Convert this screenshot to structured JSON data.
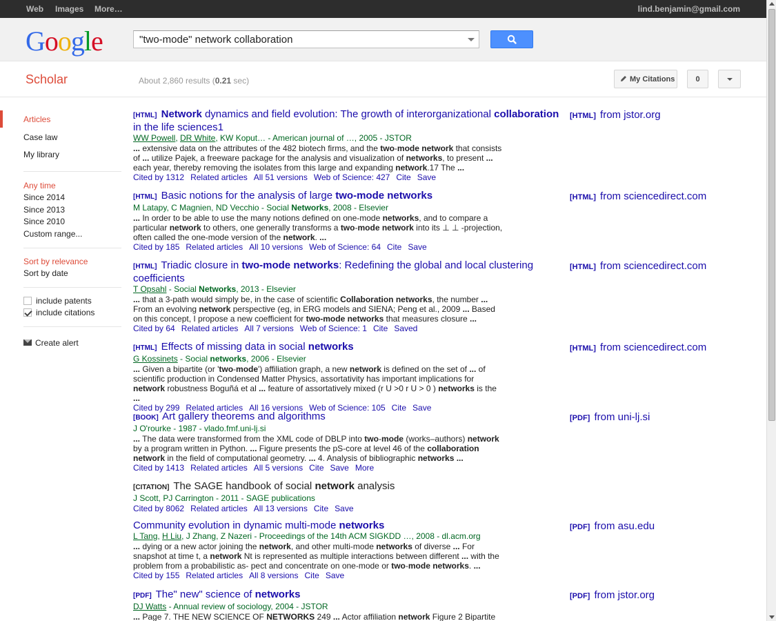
{
  "topbar": {
    "nav": [
      "Web",
      "Images",
      "More…"
    ],
    "user": "lind.benjamin@gmail.com"
  },
  "search": {
    "query": "\"two-mode\" network collaboration"
  },
  "brand": {
    "logo_letters": [
      "G",
      "o",
      "o",
      "g",
      "l",
      "e"
    ],
    "logo_colors": [
      "#3369e8",
      "#d50f25",
      "#eeb211",
      "#3369e8",
      "#009925",
      "#d50f25"
    ],
    "section": "Scholar"
  },
  "stats": {
    "prefix": "About 2,860 results (",
    "time": "0.21",
    "suffix": " sec)"
  },
  "toolbar": {
    "my_citations": "My Citations",
    "alerts_count": "0"
  },
  "sidebar": {
    "articles": "Articles",
    "case_law": "Case law",
    "my_library": "My library",
    "any_time": "Any time",
    "since_2014": "Since 2014",
    "since_2013": "Since 2013",
    "since_2010": "Since 2010",
    "custom_range": "Custom range...",
    "sort_relevance": "Sort by relevance",
    "sort_date": "Sort by date",
    "include_patents": "include patents",
    "include_citations": "include citations",
    "create_alert": "Create alert"
  },
  "results": [
    {
      "tag": "[HTML]",
      "title_parts": [
        [
          "Network",
          true
        ],
        [
          " dynamics and field evolution: The growth of interorganizational ",
          false
        ],
        [
          "collaboration",
          true
        ],
        [
          " in the life sciences1",
          false
        ]
      ],
      "meta": [
        [
          "WW Powell",
          true
        ],
        [
          ", ",
          false
        ],
        [
          "DR White",
          true
        ],
        [
          ", KW Koput… - American journal of …, 2005 - JSTOR",
          false
        ]
      ],
      "snippet": [
        [
          "...",
          true
        ],
        [
          " extensive data on the attributes of the 482 biotech firms, and the ",
          false
        ],
        [
          "two",
          true
        ],
        [
          "-",
          false
        ],
        [
          "mode network",
          true
        ],
        [
          " that consists of ",
          false
        ],
        [
          "...",
          true
        ],
        [
          " utilize Pajek, a freeware package for the analysis and visualization of ",
          false
        ],
        [
          "networks",
          true
        ],
        [
          ", to present ",
          false
        ],
        [
          "...",
          true
        ],
        [
          " each year, thereby removing the isolates from this large and expanding ",
          false
        ],
        [
          "network",
          true
        ],
        [
          ".17 The ",
          false
        ],
        [
          "...",
          true
        ]
      ],
      "links": [
        "Cited by 1312",
        "Related articles",
        "All 51 versions",
        "Web of Science: 427",
        "Cite",
        "Save"
      ],
      "side_tag": "[HTML]",
      "side_source": "from jstor.org"
    },
    {
      "tag": "[HTML]",
      "title_parts": [
        [
          "Basic notions for the analysis of large ",
          false
        ],
        [
          "two-mode networks",
          true
        ]
      ],
      "meta": [
        [
          "M Latapy, C Magnien, ND Vecchio - Social ",
          false
        ],
        [
          "Networks",
          "b"
        ],
        [
          ", 2008 - Elsevier",
          false
        ]
      ],
      "snippet": [
        [
          "...",
          true
        ],
        [
          " In order to be able to use the many notions defined on one-mode ",
          false
        ],
        [
          "networks",
          true
        ],
        [
          ", and to compare a particular ",
          false
        ],
        [
          "network",
          true
        ],
        [
          " to others, one generally transforms a ",
          false
        ],
        [
          "two",
          true
        ],
        [
          "-",
          false
        ],
        [
          "mode network",
          true
        ],
        [
          " into its ⊥ ⊥ -projection, often called the one-mode version of the ",
          false
        ],
        [
          "network",
          true
        ],
        [
          ". ",
          false
        ],
        [
          "...",
          true
        ]
      ],
      "links": [
        "Cited by 185",
        "Related articles",
        "All 10 versions",
        "Web of Science: 64",
        "Cite",
        "Save"
      ],
      "side_tag": "[HTML]",
      "side_source": "from sciencedirect.com"
    },
    {
      "tag": "[HTML]",
      "title_parts": [
        [
          "Triadic closure in ",
          false
        ],
        [
          "two-mode networks",
          true
        ],
        [
          ": Redefining the global and local clustering coefficients",
          false
        ]
      ],
      "meta": [
        [
          "T Opsahl",
          true
        ],
        [
          " - Social ",
          false
        ],
        [
          "Networks",
          "b"
        ],
        [
          ", 2013 - Elsevier",
          false
        ]
      ],
      "snippet": [
        [
          "...",
          true
        ],
        [
          " that a 3-path would simply be, in the case of scientific ",
          false
        ],
        [
          "Collaboration networks",
          true
        ],
        [
          ", the number ",
          false
        ],
        [
          "...",
          true
        ],
        [
          " From an evolving ",
          false
        ],
        [
          "network",
          true
        ],
        [
          " perspective (eg, in ERG models and SIENA; Peng et al., 2009 ",
          false
        ],
        [
          "...",
          true
        ],
        [
          " Based on this concept, I propose a new coefficient for ",
          false
        ],
        [
          "two-mode networks",
          true
        ],
        [
          " that measures closure ",
          false
        ],
        [
          "...",
          true
        ]
      ],
      "links": [
        "Cited by 64",
        "Related articles",
        "All 7 versions",
        "Web of Science: 1",
        "Cite",
        "Saved"
      ],
      "side_tag": "[HTML]",
      "side_source": "from sciencedirect.com"
    },
    {
      "tag": "[HTML]",
      "title_parts": [
        [
          "Effects of missing data in social ",
          false
        ],
        [
          "networks",
          true
        ]
      ],
      "meta": [
        [
          "G Kossinets",
          true
        ],
        [
          " - Social ",
          false
        ],
        [
          "networks",
          "b"
        ],
        [
          ", 2006 - Elsevier",
          false
        ]
      ],
      "snippet": [
        [
          "...",
          true
        ],
        [
          " Given a bipartite (or '",
          false
        ],
        [
          "two",
          true
        ],
        [
          "-",
          false
        ],
        [
          "mode",
          true
        ],
        [
          "') affiliation graph, a new ",
          false
        ],
        [
          "network",
          true
        ],
        [
          " is defined on the set of ",
          false
        ],
        [
          "...",
          true
        ],
        [
          " of scientific production in Condensed Matter Physics, assortativity has important implications for ",
          false
        ],
        [
          "network",
          true
        ],
        [
          " robustness Boguñá et al ",
          false
        ],
        [
          "...",
          true
        ],
        [
          " feature of assortatively mixed (r U >0 r U > 0 ) ",
          false
        ],
        [
          "networks",
          true
        ],
        [
          " is the ",
          false
        ],
        [
          "...",
          true
        ]
      ],
      "links": [
        "Cited by 299",
        "Related articles",
        "All 16 versions",
        "Web of Science: 105",
        "Cite",
        "Save"
      ],
      "side_tag": "[HTML]",
      "side_source": "from sciencedirect.com"
    },
    {
      "tag": "[BOOK]",
      "title_parts": [
        [
          "Art gallery theorems and algorithms",
          false
        ]
      ],
      "meta": [
        [
          "J O'rourke - 1987 - vlado.fmf.uni-lj.si",
          false
        ]
      ],
      "snippet": [
        [
          "...",
          true
        ],
        [
          " The data were transformed from the XML code of DBLP into ",
          false
        ],
        [
          "two",
          true
        ],
        [
          "-",
          false
        ],
        [
          "mode",
          true
        ],
        [
          " (works–authors) ",
          false
        ],
        [
          "network",
          true
        ],
        [
          " by a program written in Python. ",
          false
        ],
        [
          "...",
          true
        ],
        [
          " Figure presents the pS-core at level 46 of the ",
          false
        ],
        [
          "collaboration network",
          true
        ],
        [
          " in the field of computational geometry. ",
          false
        ],
        [
          "...",
          true
        ],
        [
          " 4. Analysis of bibliographic ",
          false
        ],
        [
          "networks",
          true
        ],
        [
          " ",
          false
        ],
        [
          "...",
          true
        ]
      ],
      "links": [
        "Cited by 1413",
        "Related articles",
        "All 5 versions",
        "Cite",
        "Save",
        "More"
      ],
      "side_tag": "[PDF]",
      "side_source": "from uni-lj.si"
    },
    {
      "tag": "[CITATION]",
      "plain": true,
      "title_parts": [
        [
          "The SAGE handbook of social ",
          false
        ],
        [
          "network",
          true
        ],
        [
          " analysis",
          false
        ]
      ],
      "meta": [
        [
          "J Scott, PJ Carrington - 2011 - SAGE publications",
          false
        ]
      ],
      "snippet": [],
      "links": [
        "Cited by 8062",
        "Related articles",
        "All 13 versions",
        "Cite",
        "Save"
      ],
      "side_tag": "",
      "side_source": ""
    },
    {
      "tag": "",
      "title_parts": [
        [
          "Community evolution in dynamic multi-mode ",
          false
        ],
        [
          "networks",
          true
        ]
      ],
      "meta": [
        [
          "L Tang",
          true
        ],
        [
          ", ",
          false
        ],
        [
          "H Liu",
          true
        ],
        [
          ", J Zhang, Z Nazeri - Proceedings of the 14th ACM SIGKDD …, 2008 - dl.acm.org",
          false
        ]
      ],
      "snippet": [
        [
          "...",
          true
        ],
        [
          " dying or a new actor joining the ",
          false
        ],
        [
          "network",
          true
        ],
        [
          ", and other multi-mode ",
          false
        ],
        [
          "networks",
          true
        ],
        [
          " of diverse ",
          false
        ],
        [
          "...",
          true
        ],
        [
          " For snapshot at time t, a ",
          false
        ],
        [
          "network",
          true
        ],
        [
          " Nt is represented as multiple interactions between different ",
          false
        ],
        [
          "...",
          true
        ],
        [
          " with the problem from a probabilistic as- pect and concentrate on one-mode or ",
          false
        ],
        [
          "two",
          true
        ],
        [
          "-",
          false
        ],
        [
          "mode networks",
          true
        ],
        [
          ". ",
          false
        ],
        [
          "...",
          true
        ]
      ],
      "links": [
        "Cited by 155",
        "Related articles",
        "All 8 versions",
        "Cite",
        "Save"
      ],
      "side_tag": "[PDF]",
      "side_source": "from asu.edu"
    },
    {
      "tag": "[PDF]",
      "title_parts": [
        [
          "The\" new\" science of ",
          false
        ],
        [
          "networks",
          true
        ]
      ],
      "meta": [
        [
          "DJ Watts",
          true
        ],
        [
          " - Annual review of sociology, 2004 - JSTOR",
          false
        ]
      ],
      "snippet": [
        [
          "...",
          true
        ],
        [
          " Page 7. THE NEW SCIENCE OF ",
          false
        ],
        [
          "NETWORKS",
          true
        ],
        [
          " 249 ",
          false
        ],
        [
          "...",
          true
        ],
        [
          " Actor affiliation ",
          false
        ],
        [
          "network",
          true
        ],
        [
          " Figure 2 Bipartite",
          false
        ]
      ],
      "links": [],
      "side_tag": "[PDF]",
      "side_source": "from jstor.org"
    }
  ]
}
